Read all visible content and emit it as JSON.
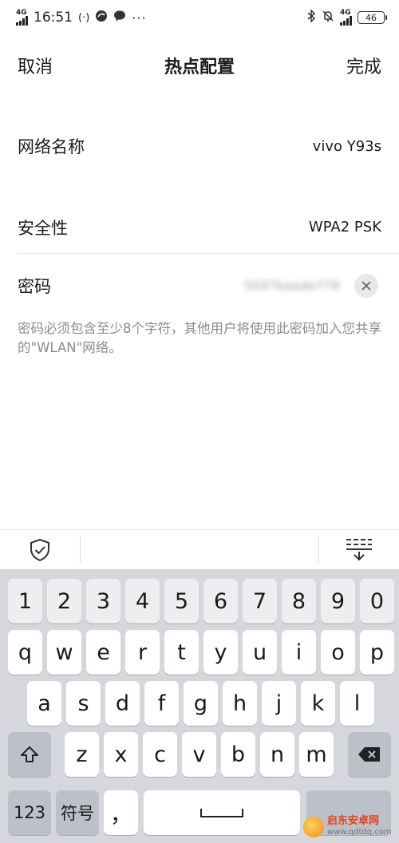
{
  "status_bar": {
    "network_small": "4G",
    "time": "16:51",
    "hotspot_glyph": "(·)",
    "right_network": "4G",
    "battery": "46"
  },
  "header": {
    "cancel_label": "取消",
    "title": "热点配置",
    "done_label": "完成"
  },
  "form": {
    "network_name_label": "网络名称",
    "network_name_value": "vivo Y93s",
    "security_label": "安全性",
    "security_value": "WPA2 PSK",
    "password_label": "密码",
    "password_value": "5697baade778",
    "hint": "密码必须包含至少8个字符，其他用户将使用此密码加入您共享的\"WLAN\"网络。"
  },
  "keyboard": {
    "numbers": [
      "1",
      "2",
      "3",
      "4",
      "5",
      "6",
      "7",
      "8",
      "9",
      "0"
    ],
    "row1": [
      "q",
      "w",
      "e",
      "r",
      "t",
      "y",
      "u",
      "i",
      "o",
      "p"
    ],
    "row2": [
      "a",
      "s",
      "d",
      "f",
      "g",
      "h",
      "j",
      "k",
      "l"
    ],
    "row3": [
      "z",
      "x",
      "c",
      "v",
      "b",
      "n",
      "m"
    ],
    "key_123": "123",
    "key_symbols": "符号",
    "key_comma": "，",
    "key_space": "⎵"
  },
  "watermark": {
    "cn": "启东安卓网",
    "url": "www.qdtdq.com"
  },
  "icons": {
    "shift": "shift-icon",
    "backspace": "backspace-icon",
    "clear": "clear-icon",
    "shield": "shield-check-icon",
    "collapse": "keyboard-collapse-icon"
  }
}
